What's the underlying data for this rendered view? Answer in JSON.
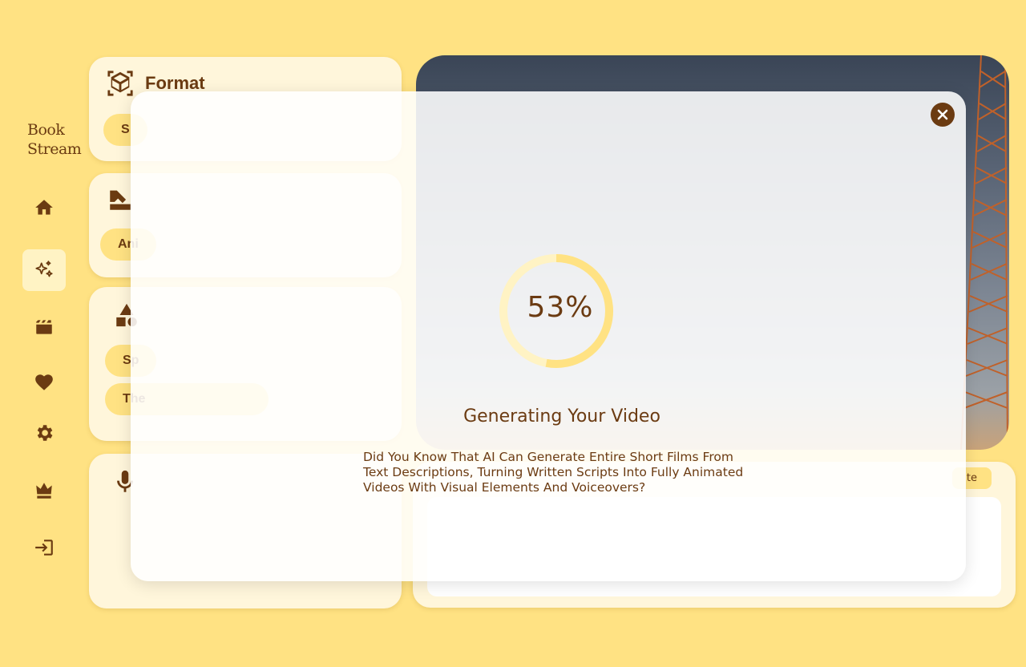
{
  "sidebar": {
    "logo_line1": "Book",
    "logo_line2": "Stream",
    "items": [
      {
        "name": "home",
        "active": false
      },
      {
        "name": "ai-generate",
        "active": true
      },
      {
        "name": "videos",
        "active": false
      },
      {
        "name": "favorites",
        "active": false
      },
      {
        "name": "settings",
        "active": false
      },
      {
        "name": "premium",
        "active": false
      },
      {
        "name": "login",
        "active": false
      }
    ]
  },
  "format_card": {
    "title": "Format",
    "options": [
      "S",
      "",
      ""
    ],
    "selected": "S"
  },
  "style_card": {
    "title": "",
    "options": [
      "Ani",
      "",
      ""
    ],
    "selected": "Ani"
  },
  "theme_card": {
    "title": "",
    "options": [
      "Sp",
      "",
      "",
      "The",
      ""
    ]
  },
  "voice_card": {
    "title": ""
  },
  "prompt_card": {
    "generate_label": "te"
  },
  "modal": {
    "progress_percent": 53,
    "progress_label": "53%",
    "title": "Generating Your Video",
    "fact": "Did You Know That AI Can Generate Entire Short Films From Text Descriptions, Turning Written Scripts Into Fully Animated Videos With Visual Elements And Voiceovers?"
  },
  "colors": {
    "background": "#ffe283",
    "brand": "#6b3b12",
    "card": "#fff6db",
    "ring_track": "#fff3c4"
  }
}
